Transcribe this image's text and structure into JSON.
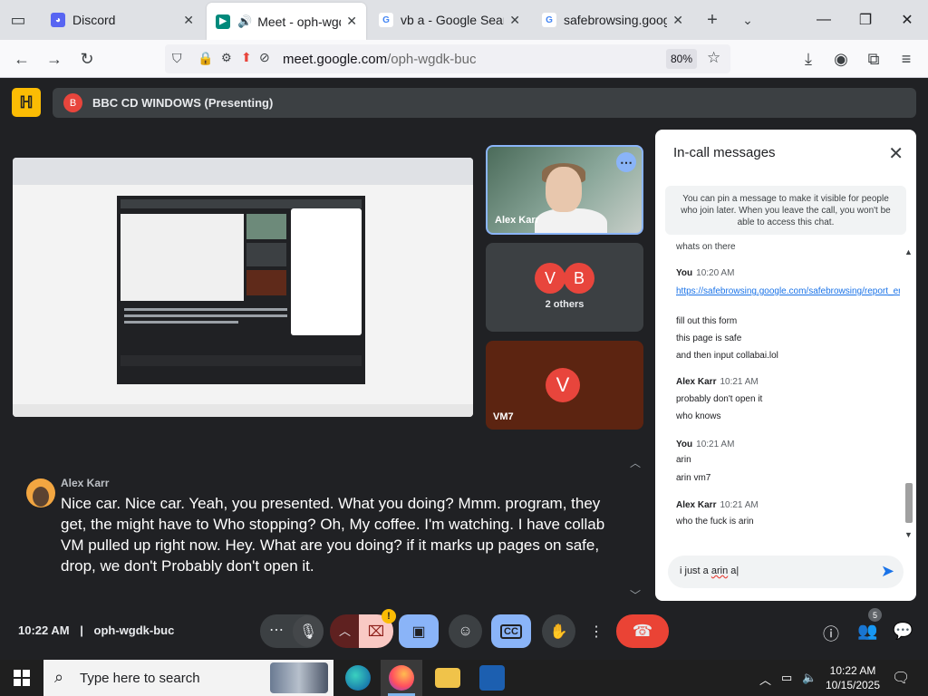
{
  "browser": {
    "tabs": [
      {
        "label": "Discord",
        "icon": "discord-icon",
        "color": "#5865f2"
      },
      {
        "label": "Meet - oph-wgdk-b",
        "icon": "meet-icon",
        "color": "#00897b"
      },
      {
        "label": "vb a - Google Search",
        "icon": "google-icon",
        "color": "#4285f4"
      },
      {
        "label": "safebrowsing.google.co",
        "icon": "google-icon",
        "color": "#4285f4"
      }
    ],
    "url_host": "meet.google.com",
    "url_path": "/oph-wgdk-buc",
    "zoom": "80%"
  },
  "meet": {
    "presenting_initial": "B",
    "presenting_label": "BBC CD WINDOWS (Presenting)",
    "tiles": {
      "alex_name": "Alex Karr",
      "others_initial_1": "V",
      "others_initial_2": "B",
      "others_count_label": "2 others",
      "vm7_initial": "V",
      "vm7_name": "VM7"
    },
    "caption": {
      "speaker": "Alex Karr",
      "text": "Nice car. Nice car. Yeah, you presented. What you doing? Mmm. program, they get, the might have to Who stopping? Oh, My coffee. I'm watching. I have collab VM pulled up right now. Hey. What are you doing? if it marks up pages on safe, drop, we don't Probably don't open it."
    },
    "clock": "10:22 AM",
    "separator": "|",
    "meeting_code": "oph-wgdk-buc",
    "people_count": "5",
    "warning_mark": "!"
  },
  "chat": {
    "title": "In-call messages",
    "notice": "You can pin a message to make it visible for people who join later. When you leave the call, you won't be able to access this chat.",
    "partial_top": "whats on there",
    "groups": [
      {
        "sender": "You",
        "time": "10:20 AM",
        "link": "https://safebrowsing.google.com/safebrowsing/report_error/",
        "lines": [
          "fill out this form",
          "this page is safe",
          "and then input collabai.lol"
        ]
      },
      {
        "sender": "Alex Karr",
        "time": "10:21 AM",
        "lines": [
          "probably don't open it",
          "who knows"
        ]
      },
      {
        "sender": "You",
        "time": "10:21 AM",
        "lines": [
          "arin",
          "arin vm7"
        ]
      },
      {
        "sender": "Alex Karr",
        "time": "10:21 AM",
        "lines": [
          "who the fuck is arin"
        ]
      }
    ],
    "input_prefix": "i just a ",
    "input_word": "arin",
    "input_suffix": " a"
  },
  "taskbar": {
    "search_placeholder": "Type here to search",
    "time": "10:22 AM",
    "date": "10/15/2025"
  },
  "colors": {
    "meet_bg": "#202124",
    "accent_blue": "#8ab4f8",
    "end_call_red": "#ea4335",
    "link_blue": "#1a73e8"
  }
}
